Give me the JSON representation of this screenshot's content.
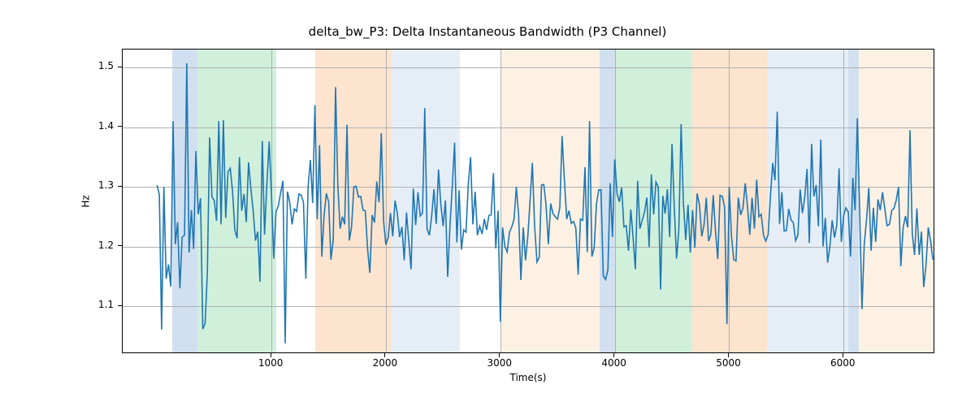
{
  "chart_data": {
    "type": "line",
    "title": "delta_bw_P3: Delta Instantaneous Bandwidth (P3 Channel)",
    "xlabel": "Time(s)",
    "ylabel": "Hz",
    "xlim": [
      -300,
      6800
    ],
    "ylim": [
      1.02,
      1.53
    ],
    "xticks": [
      1000,
      2000,
      3000,
      4000,
      5000,
      6000
    ],
    "yticks": [
      1.1,
      1.2,
      1.3,
      1.4,
      1.5
    ],
    "shaded_regions": [
      {
        "x0": 130,
        "x1": 350,
        "color": "#6699cc"
      },
      {
        "x0": 350,
        "x1": 1040,
        "color": "#66cc88"
      },
      {
        "x0": 1380,
        "x1": 2050,
        "color": "#f5a45d"
      },
      {
        "x0": 2050,
        "x1": 2650,
        "color": "#a9c7e6"
      },
      {
        "x0": 3000,
        "x1": 3870,
        "color": "#f9cfa4"
      },
      {
        "x0": 3870,
        "x1": 4010,
        "color": "#6699cc"
      },
      {
        "x0": 4010,
        "x1": 4680,
        "color": "#66cc88"
      },
      {
        "x0": 4680,
        "x1": 5330,
        "color": "#f5a45d"
      },
      {
        "x0": 5330,
        "x1": 6040,
        "color": "#a9c7e6"
      },
      {
        "x0": 6040,
        "x1": 6130,
        "color": "#6699cc"
      },
      {
        "x0": 6130,
        "x1": 6800,
        "color": "#f9cfa4"
      }
    ],
    "series": [
      {
        "name": "delta_bw_P3",
        "x_start": 0,
        "x_step": 20,
        "values": [
          1.303,
          1.287,
          1.061,
          1.3,
          1.146,
          1.17,
          1.133,
          1.41,
          1.204,
          1.241,
          1.13,
          1.216,
          1.219,
          1.507,
          1.19,
          1.261,
          1.196,
          1.36,
          1.254,
          1.281,
          1.062,
          1.071,
          1.156,
          1.383,
          1.283,
          1.277,
          1.243,
          1.41,
          1.237,
          1.412,
          1.248,
          1.325,
          1.331,
          1.293,
          1.228,
          1.214,
          1.35,
          1.26,
          1.288,
          1.241,
          1.341,
          1.298,
          1.26,
          1.21,
          1.225,
          1.141,
          1.377,
          1.22,
          1.305,
          1.376,
          1.287,
          1.18,
          1.258,
          1.268,
          1.29,
          1.31,
          1.038,
          1.292,
          1.274,
          1.237,
          1.263,
          1.259,
          1.288,
          1.286,
          1.274,
          1.146,
          1.3,
          1.345,
          1.273,
          1.437,
          1.246,
          1.37,
          1.183,
          1.253,
          1.289,
          1.275,
          1.178,
          1.212,
          1.467,
          1.302,
          1.23,
          1.25,
          1.237,
          1.404,
          1.21,
          1.233,
          1.3,
          1.301,
          1.283,
          1.284,
          1.261,
          1.26,
          1.196,
          1.156,
          1.253,
          1.24,
          1.309,
          1.274,
          1.39,
          1.243,
          1.203,
          1.215,
          1.256,
          1.217,
          1.277,
          1.256,
          1.216,
          1.233,
          1.177,
          1.257,
          1.21,
          1.162,
          1.297,
          1.236,
          1.291,
          1.251,
          1.256,
          1.432,
          1.229,
          1.219,
          1.251,
          1.296,
          1.238,
          1.329,
          1.272,
          1.234,
          1.277,
          1.149,
          1.234,
          1.3,
          1.374,
          1.207,
          1.294,
          1.195,
          1.228,
          1.224,
          1.305,
          1.35,
          1.237,
          1.292,
          1.219,
          1.234,
          1.221,
          1.246,
          1.228,
          1.252,
          1.253,
          1.323,
          1.197,
          1.26,
          1.074,
          1.232,
          1.2,
          1.191,
          1.224,
          1.233,
          1.246,
          1.3,
          1.253,
          1.144,
          1.232,
          1.177,
          1.216,
          1.277,
          1.34,
          1.234,
          1.174,
          1.182,
          1.303,
          1.304,
          1.269,
          1.204,
          1.272,
          1.255,
          1.25,
          1.246,
          1.265,
          1.385,
          1.311,
          1.246,
          1.26,
          1.239,
          1.242,
          1.231,
          1.153,
          1.246,
          1.244,
          1.333,
          1.191,
          1.41,
          1.183,
          1.198,
          1.271,
          1.295,
          1.295,
          1.151,
          1.145,
          1.161,
          1.306,
          1.216,
          1.346,
          1.288,
          1.275,
          1.299,
          1.233,
          1.235,
          1.193,
          1.262,
          1.215,
          1.162,
          1.31,
          1.23,
          1.244,
          1.258,
          1.282,
          1.199,
          1.321,
          1.254,
          1.308,
          1.3,
          1.128,
          1.285,
          1.255,
          1.296,
          1.216,
          1.372,
          1.264,
          1.18,
          1.228,
          1.405,
          1.272,
          1.211,
          1.27,
          1.19,
          1.261,
          1.198,
          1.289,
          1.27,
          1.217,
          1.236,
          1.282,
          1.209,
          1.22,
          1.286,
          1.226,
          1.179,
          1.286,
          1.284,
          1.266,
          1.07,
          1.3,
          1.217,
          1.178,
          1.176,
          1.282,
          1.253,
          1.264,
          1.306,
          1.267,
          1.22,
          1.282,
          1.23,
          1.312,
          1.25,
          1.254,
          1.219,
          1.209,
          1.22,
          1.283,
          1.34,
          1.311,
          1.426,
          1.238,
          1.291,
          1.226,
          1.227,
          1.263,
          1.245,
          1.24,
          1.21,
          1.219,
          1.296,
          1.256,
          1.282,
          1.33,
          1.206,
          1.372,
          1.284,
          1.303,
          1.234,
          1.379,
          1.2,
          1.248,
          1.173,
          1.2,
          1.244,
          1.215,
          1.236,
          1.331,
          1.208,
          1.252,
          1.265,
          1.258,
          1.183,
          1.315,
          1.261,
          1.415,
          1.261,
          1.095,
          1.204,
          1.245,
          1.298,
          1.193,
          1.265,
          1.208,
          1.279,
          1.261,
          1.291,
          1.263,
          1.235,
          1.237,
          1.26,
          1.264,
          1.278,
          1.3,
          1.167,
          1.232,
          1.251,
          1.232,
          1.395,
          1.222,
          1.186,
          1.264,
          1.186,
          1.225,
          1.132,
          1.169,
          1.232,
          1.209,
          1.178
        ]
      }
    ]
  }
}
